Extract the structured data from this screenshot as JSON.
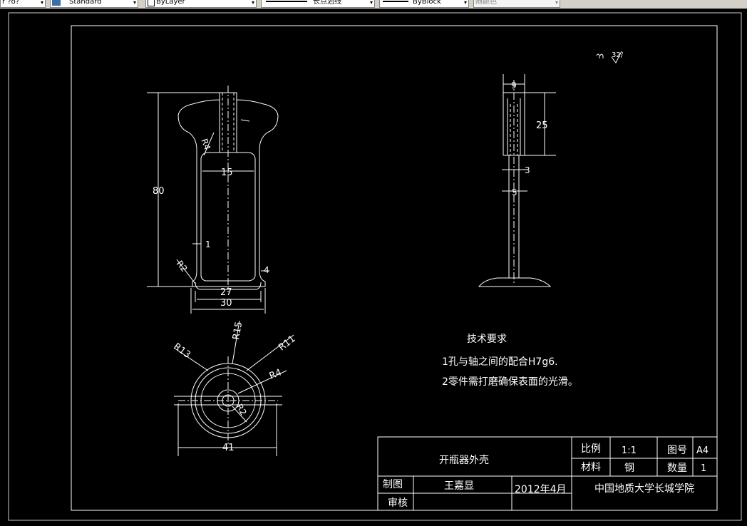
{
  "toolbar": {
    "layer_value": "r ?o?",
    "text_style": "Standard",
    "color_value": "ByLayer",
    "linetype_value": "长点划线",
    "lineweight_value": "ByBlock",
    "plot_style": "随颜色"
  },
  "drawing": {
    "roughness_mark": "32/",
    "dims": {
      "d80": "80",
      "d15": "15",
      "d1": "1",
      "d4": "4",
      "d27": "27",
      "d30": "30",
      "r4": "R4",
      "r2": "R2",
      "d9": "9",
      "d25": "25",
      "d3": "3",
      "d5": "5",
      "r15": "R15",
      "r11": "R11",
      "r13": "R13",
      "r4b": "R4",
      "r2b": "R2",
      "d41": "41"
    },
    "tech": {
      "title": "技术要求",
      "req1": "1孔与轴之间的配合H7g6.",
      "req2": "2零件需打磨确保表面的光滑。"
    },
    "title_block": {
      "part_name": "开瓶器外壳",
      "scale_label": "比例",
      "scale_value": "1:1",
      "drawing_no_label": "图号",
      "drawing_no_value": "A4",
      "material_label": "材料",
      "material_value": "钢",
      "quantity_label": "数量",
      "quantity_value": "1",
      "drawn_label": "制图",
      "drawn_by": "王嘉显",
      "date": "2012年4月",
      "check_label": "审核",
      "institution": "中国地质大学长城学院"
    }
  }
}
